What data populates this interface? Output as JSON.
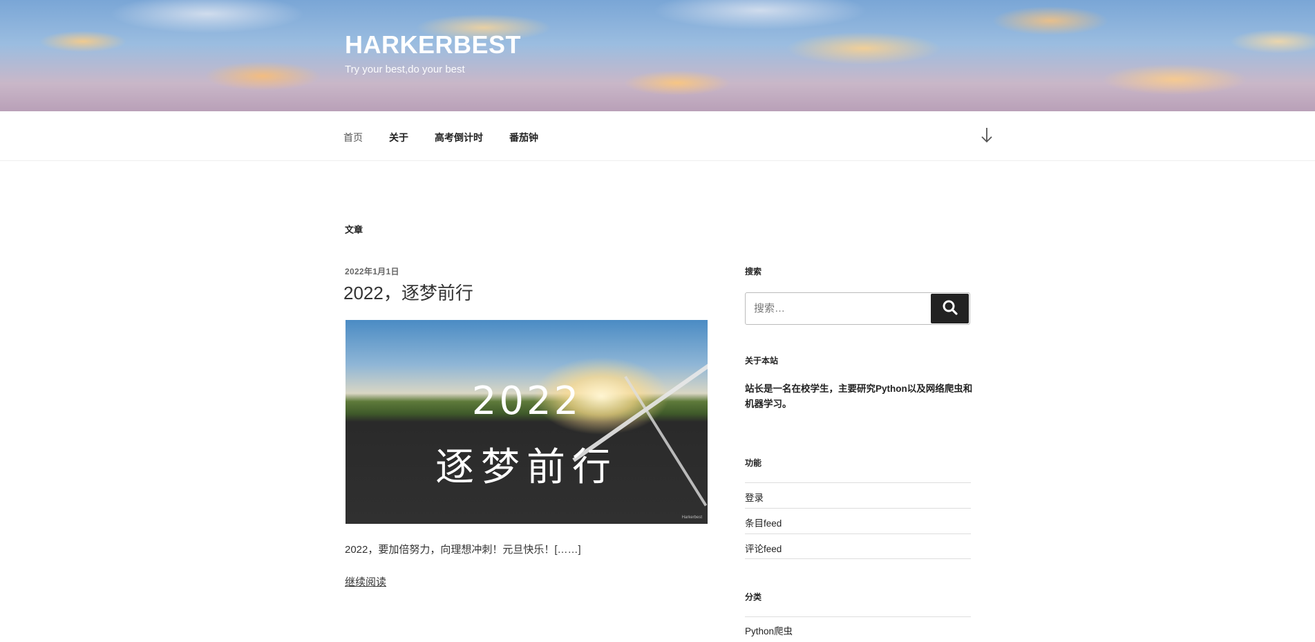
{
  "site": {
    "title": "HARKERBEST",
    "description": "Try your best,do your best"
  },
  "nav": {
    "items": [
      {
        "label": "首页",
        "current": true
      },
      {
        "label": "关于"
      },
      {
        "label": "高考倒计时"
      },
      {
        "label": "番茄钟"
      }
    ],
    "scroll_icon": "arrow-down-icon"
  },
  "main": {
    "archive_title": "文章",
    "post": {
      "date": "2022年1月1日",
      "title": "2022，逐梦前行",
      "image_text_line1": "2022",
      "image_text_line2": "逐梦前行",
      "image_credit": "Harkerbest",
      "excerpt": "2022，要加倍努力，向理想冲刺！元旦快乐！[……]",
      "read_more": "继续阅读"
    }
  },
  "sidebar": {
    "search": {
      "title": "搜索",
      "placeholder": "搜索…",
      "button_icon": "search-icon"
    },
    "about": {
      "title": "关于本站",
      "text": "站长是一名在校学生，主要研究Python以及网络爬虫和机器学习。"
    },
    "functions": {
      "title": "功能",
      "items": [
        "登录",
        "条目feed",
        "评论feed"
      ]
    },
    "categories": {
      "title": "分类",
      "items": [
        "Python爬虫"
      ]
    }
  },
  "colors": {
    "text": "#222222",
    "button": "#222222",
    "divider": "#dddddd"
  }
}
